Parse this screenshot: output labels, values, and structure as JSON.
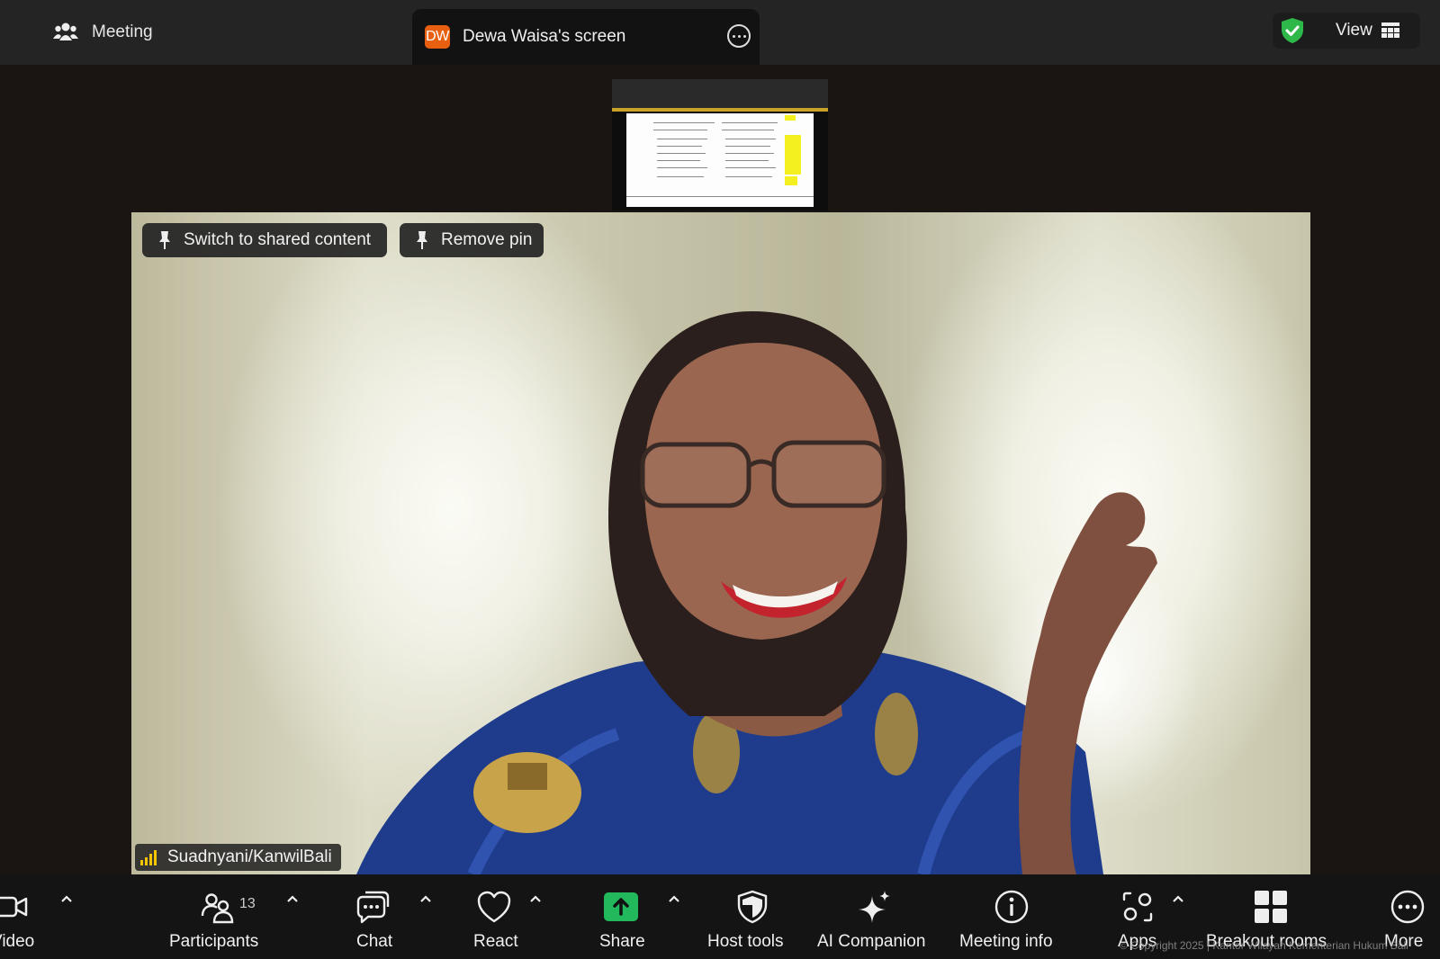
{
  "header": {
    "meeting_tab_label": "Meeting",
    "screen_tab_avatar": "DW",
    "screen_tab_label": "Dewa Waisa's screen",
    "view_label": "View",
    "colors": {
      "avatar": "#e8600f",
      "shield": "#2fb84a"
    }
  },
  "video": {
    "switch_label": "Switch to shared content",
    "remove_pin_label": "Remove pin",
    "participant_name": "Suadnyani/KanwilBali"
  },
  "toolbar": {
    "video_label": "Video",
    "participants_label": "Participants",
    "participants_count": "13",
    "chat_label": "Chat",
    "react_label": "React",
    "share_label": "Share",
    "host_tools_label": "Host tools",
    "ai_companion_label": "AI Companion",
    "meeting_info_label": "Meeting info",
    "apps_label": "Apps",
    "breakout_label": "Breakout rooms",
    "more_label": "More",
    "share_color": "#22b85c"
  },
  "footer": {
    "copyright": "© Copyright 2025 | Kantor Wilayah Kementerian Hukum Bali"
  }
}
